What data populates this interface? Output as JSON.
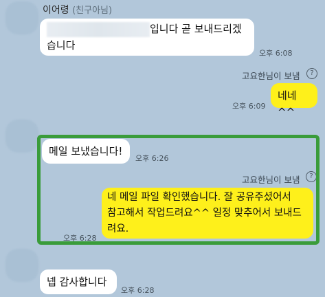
{
  "chat": {
    "sender_name": "이어령",
    "sender_sub": "(친구아님)",
    "messages": [
      {
        "text": "입니다 곧 보내드리겠\n습니다",
        "time": "오후 6:08"
      },
      {
        "via": "고요한님이 보냄",
        "help": "?",
        "text": "네네^^",
        "time": "오후 6:09"
      },
      {
        "text": "메일 보냈습니다!",
        "time": "오후 6:26"
      },
      {
        "via": "고요한님이 보냄",
        "help": "?",
        "text": "네 메일 파일 확인했습니다. 잘 공유주셨어서\n참고해서 작업드려요^^ 일정 맞추어서 보내드\n려요.",
        "time": "오후 6:28"
      },
      {
        "text": "넵 감사합니다",
        "time": "오후 6:28"
      }
    ]
  },
  "colors": {
    "background": "#b2c7da",
    "my_bubble": "#fef01b",
    "their_bubble": "#ffffff",
    "highlight_border": "#3a9c3a"
  }
}
